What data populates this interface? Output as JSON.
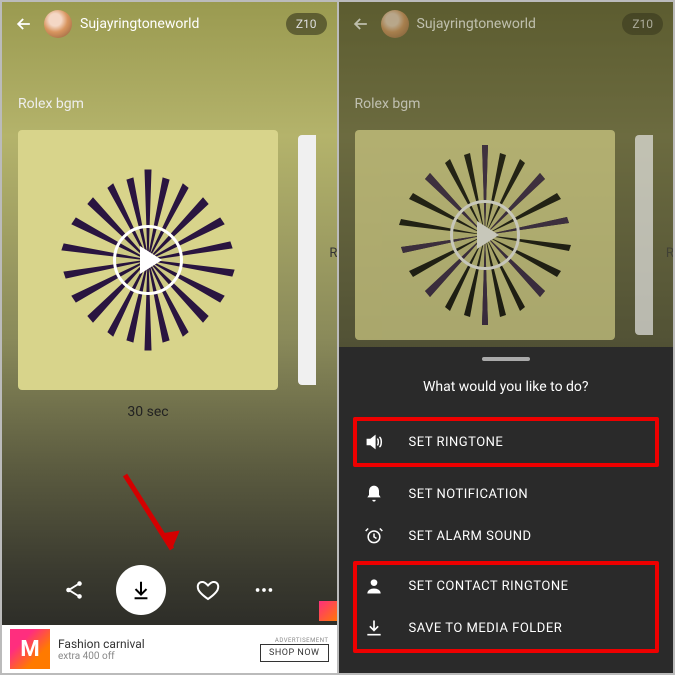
{
  "left": {
    "username": "Sujayringtoneworld",
    "badge": "Z10",
    "title": "Rolex bgm",
    "peek_label": "Ri",
    "duration": "30 sec",
    "ad": {
      "logo_letter": "M",
      "title": "Fashion carnival",
      "sub": "extra 400 off",
      "tag": "ADVERTISEMENT",
      "button": "SHOP NOW"
    }
  },
  "right": {
    "username": "Sujayringtoneworld",
    "badge": "Z10",
    "title": "Rolex bgm",
    "peek_label": "Ri",
    "sheet": {
      "title": "What would you like to do?",
      "items": [
        {
          "label": "SET RINGTONE"
        },
        {
          "label": "SET NOTIFICATION"
        },
        {
          "label": "SET ALARM SOUND"
        },
        {
          "label": "SET CONTACT RINGTONE"
        },
        {
          "label": "SAVE TO MEDIA FOLDER"
        }
      ]
    }
  }
}
